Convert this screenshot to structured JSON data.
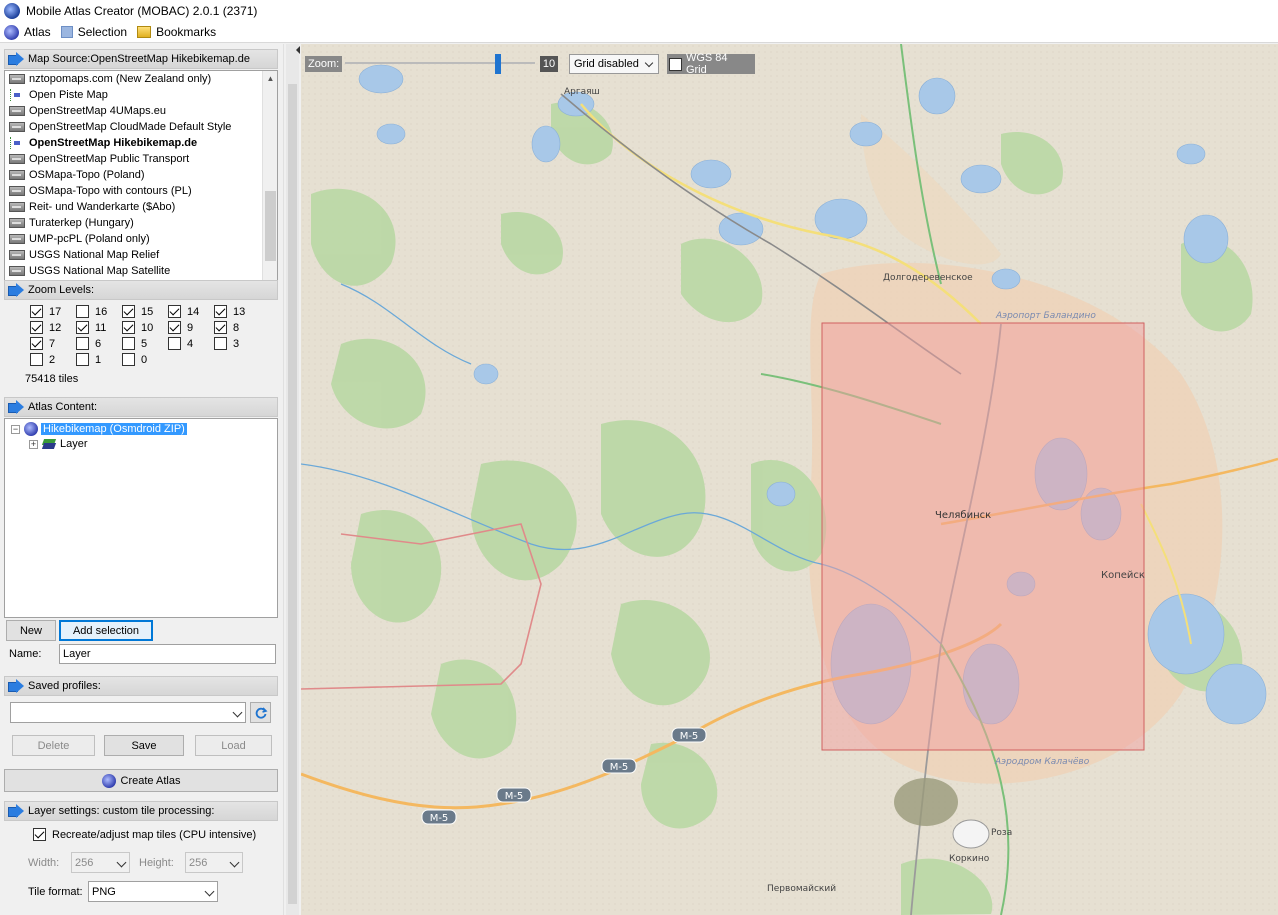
{
  "window": {
    "title": "Mobile Atlas Creator (MOBAC) 2.0.1 (2371)"
  },
  "menu": [
    {
      "label": "Atlas",
      "icon": "globe-icon"
    },
    {
      "label": "Selection",
      "icon": "selection-icon"
    },
    {
      "label": "Bookmarks",
      "icon": "bookmark-folder-icon"
    }
  ],
  "map_source": {
    "header": "Map Source:OpenStreetMap Hikebikemap.de",
    "items": [
      {
        "label": "nztopomaps.com (New Zealand only)",
        "icon": "server"
      },
      {
        "label": "Open Piste Map",
        "icon": "multi"
      },
      {
        "label": "OpenStreetMap 4UMaps.eu",
        "icon": "server"
      },
      {
        "label": "OpenStreetMap CloudMade Default Style",
        "icon": "server"
      },
      {
        "label": "OpenStreetMap Hikebikemap.de",
        "icon": "multi",
        "selected": true
      },
      {
        "label": "OpenStreetMap Public Transport",
        "icon": "server"
      },
      {
        "label": "OSMapa-Topo (Poland)",
        "icon": "server"
      },
      {
        "label": "OSMapa-Topo with contours (PL)",
        "icon": "server"
      },
      {
        "label": "Reit- und Wanderkarte ($Abo)",
        "icon": "server"
      },
      {
        "label": "Turaterkep (Hungary)",
        "icon": "server"
      },
      {
        "label": "UMP-pcPL (Poland only)",
        "icon": "server"
      },
      {
        "label": "USGS National Map Relief",
        "icon": "server"
      },
      {
        "label": "USGS National Map Satellite",
        "icon": "server"
      }
    ]
  },
  "zoom_levels": {
    "header": "Zoom Levels:",
    "levels": [
      {
        "label": "17",
        "checked": true
      },
      {
        "label": "16",
        "checked": false
      },
      {
        "label": "15",
        "checked": true
      },
      {
        "label": "14",
        "checked": true
      },
      {
        "label": "13",
        "checked": true
      },
      {
        "label": "12",
        "checked": true
      },
      {
        "label": "11",
        "checked": true
      },
      {
        "label": "10",
        "checked": true
      },
      {
        "label": "9",
        "checked": true
      },
      {
        "label": "8",
        "checked": true
      },
      {
        "label": "7",
        "checked": true
      },
      {
        "label": "6",
        "checked": false
      },
      {
        "label": "5",
        "checked": false
      },
      {
        "label": "4",
        "checked": false
      },
      {
        "label": "3",
        "checked": false
      },
      {
        "label": "2",
        "checked": false
      },
      {
        "label": "1",
        "checked": false
      },
      {
        "label": "0",
        "checked": false
      }
    ],
    "tile_count": "75418 tiles"
  },
  "atlas_content": {
    "header": "Atlas Content:",
    "atlas_name": "Hikebikemap (Osmdroid ZIP)",
    "layer_name": "Layer",
    "new_label": "New",
    "add_selection_label": "Add selection",
    "name_label": "Name:",
    "name_value": "Layer"
  },
  "saved_profiles": {
    "header": "Saved profiles:",
    "value": "",
    "delete_label": "Delete",
    "save_label": "Save",
    "load_label": "Load"
  },
  "create_atlas_label": "Create Atlas",
  "layer_settings": {
    "header": "Layer settings: custom tile processing:",
    "recreate_label": "Recreate/adjust map tiles (CPU intensive)",
    "recreate_checked": true,
    "width_label": "Width:",
    "width_value": "256",
    "height_label": "Height:",
    "height_value": "256",
    "format_label": "Tile format:",
    "format_value": "PNG"
  },
  "map": {
    "zoom_label": "Zoom:",
    "zoom_value": "10",
    "zoom_fraction": 0.55,
    "grid_value": "Grid disabled",
    "wgs_label": "WGS 84 Grid",
    "wgs_checked": false,
    "places": {
      "argayash": "Аргаяш",
      "dolgoderevenskoe": "Долгодеревенское",
      "airport_balandino": "Аэропорт Баландино",
      "chelyabinsk": "Челябинск",
      "kopeysk": "Копейск",
      "airport_kalachevo": "Аэродром Калачёво",
      "roza": "Роза",
      "korkino": "Коркино",
      "pervomaysky": "Первомайский",
      "m5": "М-5"
    },
    "colors": {
      "selection_fill": "#f2a0a0",
      "selection_border": "#d06060",
      "water": "#a8c8e8",
      "forest": "#b8d8a0"
    }
  }
}
